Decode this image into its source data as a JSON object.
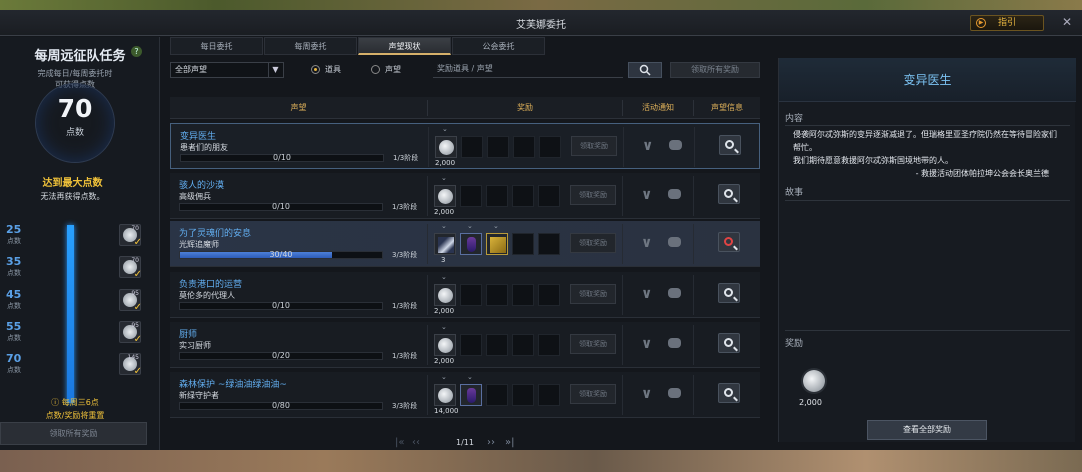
{
  "window": {
    "title": "艾芙娜委托",
    "guide_label": "指引"
  },
  "left": {
    "title": "每周远征队任务",
    "sub1": "完成每日/每周委托时",
    "sub2": "可获得点数",
    "points": "70",
    "points_label": "点数",
    "max_title": "达到最大点数",
    "max_desc": "无法再获得点数。",
    "tiers": [
      {
        "value": "25",
        "unit": "点数",
        "qty": "70"
      },
      {
        "value": "35",
        "unit": "点数",
        "qty": "70"
      },
      {
        "value": "45",
        "unit": "点数",
        "qty": "95"
      },
      {
        "value": "55",
        "unit": "点数",
        "qty": "95"
      },
      {
        "value": "70",
        "unit": "点数",
        "qty": "145"
      }
    ],
    "reset_note1": "每周三6点",
    "reset_note2": "点数/奖励将重置",
    "claim_all": "领取所有奖励"
  },
  "tabs": [
    "每日委托",
    "每周委托",
    "声望现状",
    "公会委托"
  ],
  "active_tab": 2,
  "filters": {
    "select_value": "全部声望",
    "radio1": "道具",
    "radio2": "声望",
    "search_placeholder": "奖励道具 / 声望",
    "claim_all": "领取所有奖励"
  },
  "table": {
    "headers": {
      "reputation": "声望",
      "reward": "奖励",
      "notify": "活动通知",
      "info": "声望信息"
    },
    "claim_label": "领取奖励",
    "rows": [
      {
        "name": "变异医生",
        "rank": "患者们的朋友",
        "progress": "0/10",
        "fill": 0,
        "stage": "1/3阶段",
        "reward_qty": "2,000",
        "extra": []
      },
      {
        "name": "骇人的沙漠",
        "rank": "高级佣兵",
        "progress": "0/10",
        "fill": 0,
        "stage": "1/3阶段",
        "reward_qty": "2,000",
        "extra": []
      },
      {
        "name": "为了灵魂们的安息",
        "rank": "光辉追魔师",
        "progress": "30/40",
        "fill": 0.75,
        "stage": "3/3阶段",
        "reward_qty": "3",
        "extra": [
          "potion",
          "book"
        ]
      },
      {
        "name": "负责港口的运营",
        "rank": "莫伦多的代理人",
        "progress": "0/10",
        "fill": 0,
        "stage": "1/3阶段",
        "reward_qty": "2,000",
        "extra": []
      },
      {
        "name": "厨师",
        "rank": "实习厨师",
        "progress": "0/20",
        "fill": 0,
        "stage": "1/3阶段",
        "reward_qty": "2,000",
        "extra": []
      },
      {
        "name": "森林保护 ~绿油油绿油油~",
        "rank": "新绿守护者",
        "progress": "0/80",
        "fill": 0,
        "stage": "3/3阶段",
        "reward_qty": "14,000",
        "extra": [
          "potion"
        ]
      }
    ]
  },
  "pager": {
    "page": "1/11"
  },
  "detail": {
    "title": "变异医生",
    "content_label": "内容",
    "content_lines": [
      "侵袭阿尔忒弥斯的变异逐渐减退了。但瑞格里亚圣疗院仍然在等待冒险家们帮忙。",
      "我们期待愿意救援阿尔忒弥斯国境地带的人。"
    ],
    "signature": "- 救援活动团体帕拉坤公会会长奥兰德",
    "story_label": "故事",
    "reward_label": "奖励",
    "reward_qty": "2,000",
    "view_all": "查看全部奖励"
  }
}
